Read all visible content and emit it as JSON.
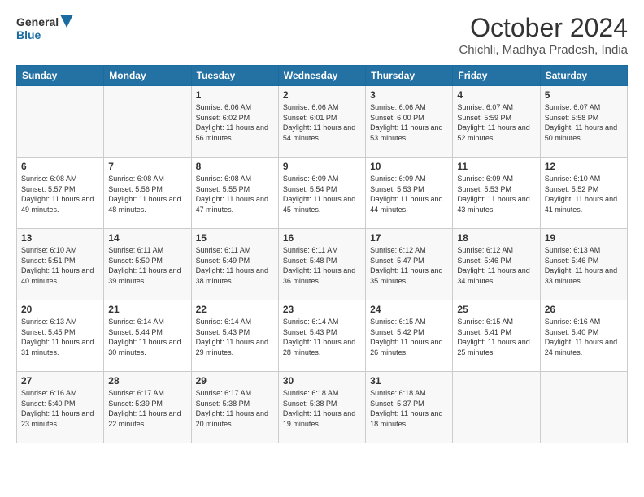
{
  "header": {
    "logo_line1": "General",
    "logo_line2": "Blue",
    "month": "October 2024",
    "location": "Chichli, Madhya Pradesh, India"
  },
  "weekdays": [
    "Sunday",
    "Monday",
    "Tuesday",
    "Wednesday",
    "Thursday",
    "Friday",
    "Saturday"
  ],
  "rows": [
    [
      {
        "day": "",
        "content": ""
      },
      {
        "day": "",
        "content": ""
      },
      {
        "day": "1",
        "content": "Sunrise: 6:06 AM\nSunset: 6:02 PM\nDaylight: 11 hours and 56 minutes."
      },
      {
        "day": "2",
        "content": "Sunrise: 6:06 AM\nSunset: 6:01 PM\nDaylight: 11 hours and 54 minutes."
      },
      {
        "day": "3",
        "content": "Sunrise: 6:06 AM\nSunset: 6:00 PM\nDaylight: 11 hours and 53 minutes."
      },
      {
        "day": "4",
        "content": "Sunrise: 6:07 AM\nSunset: 5:59 PM\nDaylight: 11 hours and 52 minutes."
      },
      {
        "day": "5",
        "content": "Sunrise: 6:07 AM\nSunset: 5:58 PM\nDaylight: 11 hours and 50 minutes."
      }
    ],
    [
      {
        "day": "6",
        "content": "Sunrise: 6:08 AM\nSunset: 5:57 PM\nDaylight: 11 hours and 49 minutes."
      },
      {
        "day": "7",
        "content": "Sunrise: 6:08 AM\nSunset: 5:56 PM\nDaylight: 11 hours and 48 minutes."
      },
      {
        "day": "8",
        "content": "Sunrise: 6:08 AM\nSunset: 5:55 PM\nDaylight: 11 hours and 47 minutes."
      },
      {
        "day": "9",
        "content": "Sunrise: 6:09 AM\nSunset: 5:54 PM\nDaylight: 11 hours and 45 minutes."
      },
      {
        "day": "10",
        "content": "Sunrise: 6:09 AM\nSunset: 5:53 PM\nDaylight: 11 hours and 44 minutes."
      },
      {
        "day": "11",
        "content": "Sunrise: 6:09 AM\nSunset: 5:53 PM\nDaylight: 11 hours and 43 minutes."
      },
      {
        "day": "12",
        "content": "Sunrise: 6:10 AM\nSunset: 5:52 PM\nDaylight: 11 hours and 41 minutes."
      }
    ],
    [
      {
        "day": "13",
        "content": "Sunrise: 6:10 AM\nSunset: 5:51 PM\nDaylight: 11 hours and 40 minutes."
      },
      {
        "day": "14",
        "content": "Sunrise: 6:11 AM\nSunset: 5:50 PM\nDaylight: 11 hours and 39 minutes."
      },
      {
        "day": "15",
        "content": "Sunrise: 6:11 AM\nSunset: 5:49 PM\nDaylight: 11 hours and 38 minutes."
      },
      {
        "day": "16",
        "content": "Sunrise: 6:11 AM\nSunset: 5:48 PM\nDaylight: 11 hours and 36 minutes."
      },
      {
        "day": "17",
        "content": "Sunrise: 6:12 AM\nSunset: 5:47 PM\nDaylight: 11 hours and 35 minutes."
      },
      {
        "day": "18",
        "content": "Sunrise: 6:12 AM\nSunset: 5:46 PM\nDaylight: 11 hours and 34 minutes."
      },
      {
        "day": "19",
        "content": "Sunrise: 6:13 AM\nSunset: 5:46 PM\nDaylight: 11 hours and 33 minutes."
      }
    ],
    [
      {
        "day": "20",
        "content": "Sunrise: 6:13 AM\nSunset: 5:45 PM\nDaylight: 11 hours and 31 minutes."
      },
      {
        "day": "21",
        "content": "Sunrise: 6:14 AM\nSunset: 5:44 PM\nDaylight: 11 hours and 30 minutes."
      },
      {
        "day": "22",
        "content": "Sunrise: 6:14 AM\nSunset: 5:43 PM\nDaylight: 11 hours and 29 minutes."
      },
      {
        "day": "23",
        "content": "Sunrise: 6:14 AM\nSunset: 5:43 PM\nDaylight: 11 hours and 28 minutes."
      },
      {
        "day": "24",
        "content": "Sunrise: 6:15 AM\nSunset: 5:42 PM\nDaylight: 11 hours and 26 minutes."
      },
      {
        "day": "25",
        "content": "Sunrise: 6:15 AM\nSunset: 5:41 PM\nDaylight: 11 hours and 25 minutes."
      },
      {
        "day": "26",
        "content": "Sunrise: 6:16 AM\nSunset: 5:40 PM\nDaylight: 11 hours and 24 minutes."
      }
    ],
    [
      {
        "day": "27",
        "content": "Sunrise: 6:16 AM\nSunset: 5:40 PM\nDaylight: 11 hours and 23 minutes."
      },
      {
        "day": "28",
        "content": "Sunrise: 6:17 AM\nSunset: 5:39 PM\nDaylight: 11 hours and 22 minutes."
      },
      {
        "day": "29",
        "content": "Sunrise: 6:17 AM\nSunset: 5:38 PM\nDaylight: 11 hours and 20 minutes."
      },
      {
        "day": "30",
        "content": "Sunrise: 6:18 AM\nSunset: 5:38 PM\nDaylight: 11 hours and 19 minutes."
      },
      {
        "day": "31",
        "content": "Sunrise: 6:18 AM\nSunset: 5:37 PM\nDaylight: 11 hours and 18 minutes."
      },
      {
        "day": "",
        "content": ""
      },
      {
        "day": "",
        "content": ""
      }
    ]
  ]
}
